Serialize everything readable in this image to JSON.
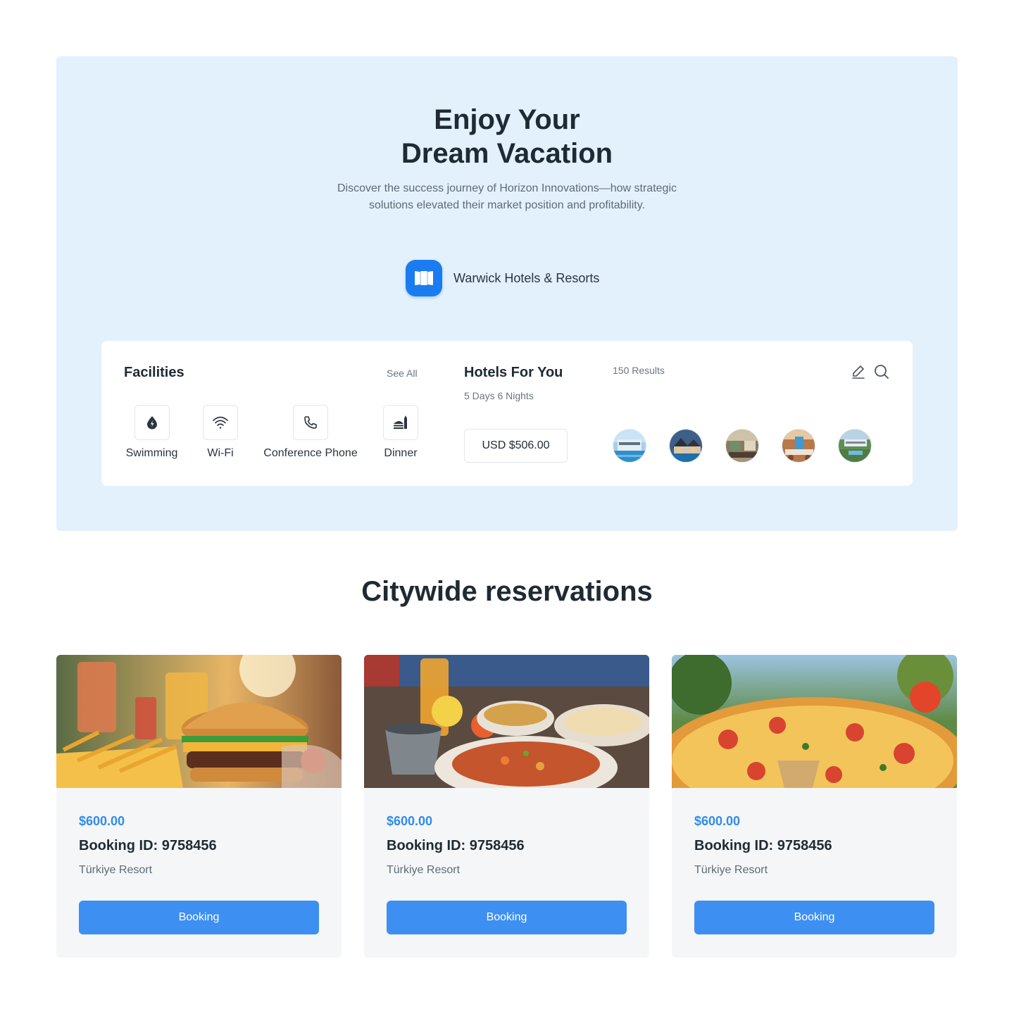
{
  "hero": {
    "title_line1": "Enjoy Your",
    "title_line2": "Dream Vacation",
    "subtitle_line1": "Discover the success journey of Horizon Innovations—how strategic",
    "subtitle_line2": "solutions elevated their market position and profitability.",
    "brand_name": "Warwick Hotels & Resorts"
  },
  "facilities": {
    "title": "Facilities",
    "see_all": "See All",
    "items": [
      {
        "label": "Swimming",
        "icon": "water-drop-icon"
      },
      {
        "label": "Wi-Fi",
        "icon": "wifi-icon"
      },
      {
        "label": "Conference Phone",
        "icon": "phone-icon"
      },
      {
        "label": "Dinner",
        "icon": "dinner-icon"
      }
    ]
  },
  "hotels": {
    "title": "Hotels For You",
    "duration": "5 Days 6 Nights",
    "results": "150 Results",
    "price": "USD $506.00",
    "icons": [
      "edit-icon",
      "search-icon"
    ]
  },
  "section": {
    "title": "Citywide reservations"
  },
  "cards": [
    {
      "price": "$600.00",
      "booking_id": "Booking ID: 9758456",
      "location": "Türkiye Resort",
      "button": "Booking",
      "image": "burger-fries-photo"
    },
    {
      "price": "$600.00",
      "booking_id": "Booking ID: 9758456",
      "location": "Türkiye Resort",
      "button": "Booking",
      "image": "curry-flatbread-photo"
    },
    {
      "price": "$600.00",
      "booking_id": "Booking ID: 9758456",
      "location": "Türkiye Resort",
      "button": "Booking",
      "image": "pizza-photo"
    }
  ],
  "colors": {
    "hero_bg": "#e3f1fd",
    "brand_blue": "#1a7cf0",
    "button_blue": "#3d8ff2",
    "price_blue": "#2f8ceb"
  }
}
